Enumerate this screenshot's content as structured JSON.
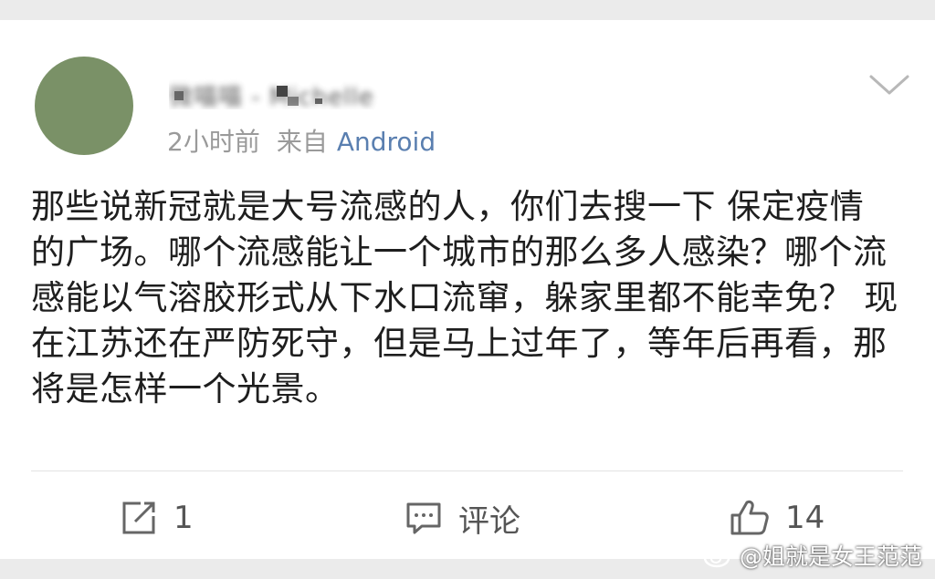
{
  "post": {
    "avatar_color": "#7a9167",
    "username": "微喵喵 - Michelle",
    "time": "2小时前",
    "source_prefix": "来自",
    "source_name": "Android",
    "text": "那些说新冠就是大号流感的人，你们去搜一下 保定疫情 的广场。哪个流感能让一个城市的那么多人感染？哪个流感能以气溶胶形式从下水口流窜，躲家里都不能幸免？ 现在江苏还在严防死守，但是马上过年了，等年后再看，那将是怎样一个光景。"
  },
  "actions": {
    "repost_count": "1",
    "comment_label": "评论",
    "like_count": "14"
  },
  "watermark": {
    "text": "@姐就是女王范范"
  },
  "icons": {
    "menu": "chevron-down-icon",
    "repost": "repost-icon",
    "comment": "comment-icon",
    "like": "thumbs-up-icon",
    "watermark": "weibo-logo-icon"
  }
}
